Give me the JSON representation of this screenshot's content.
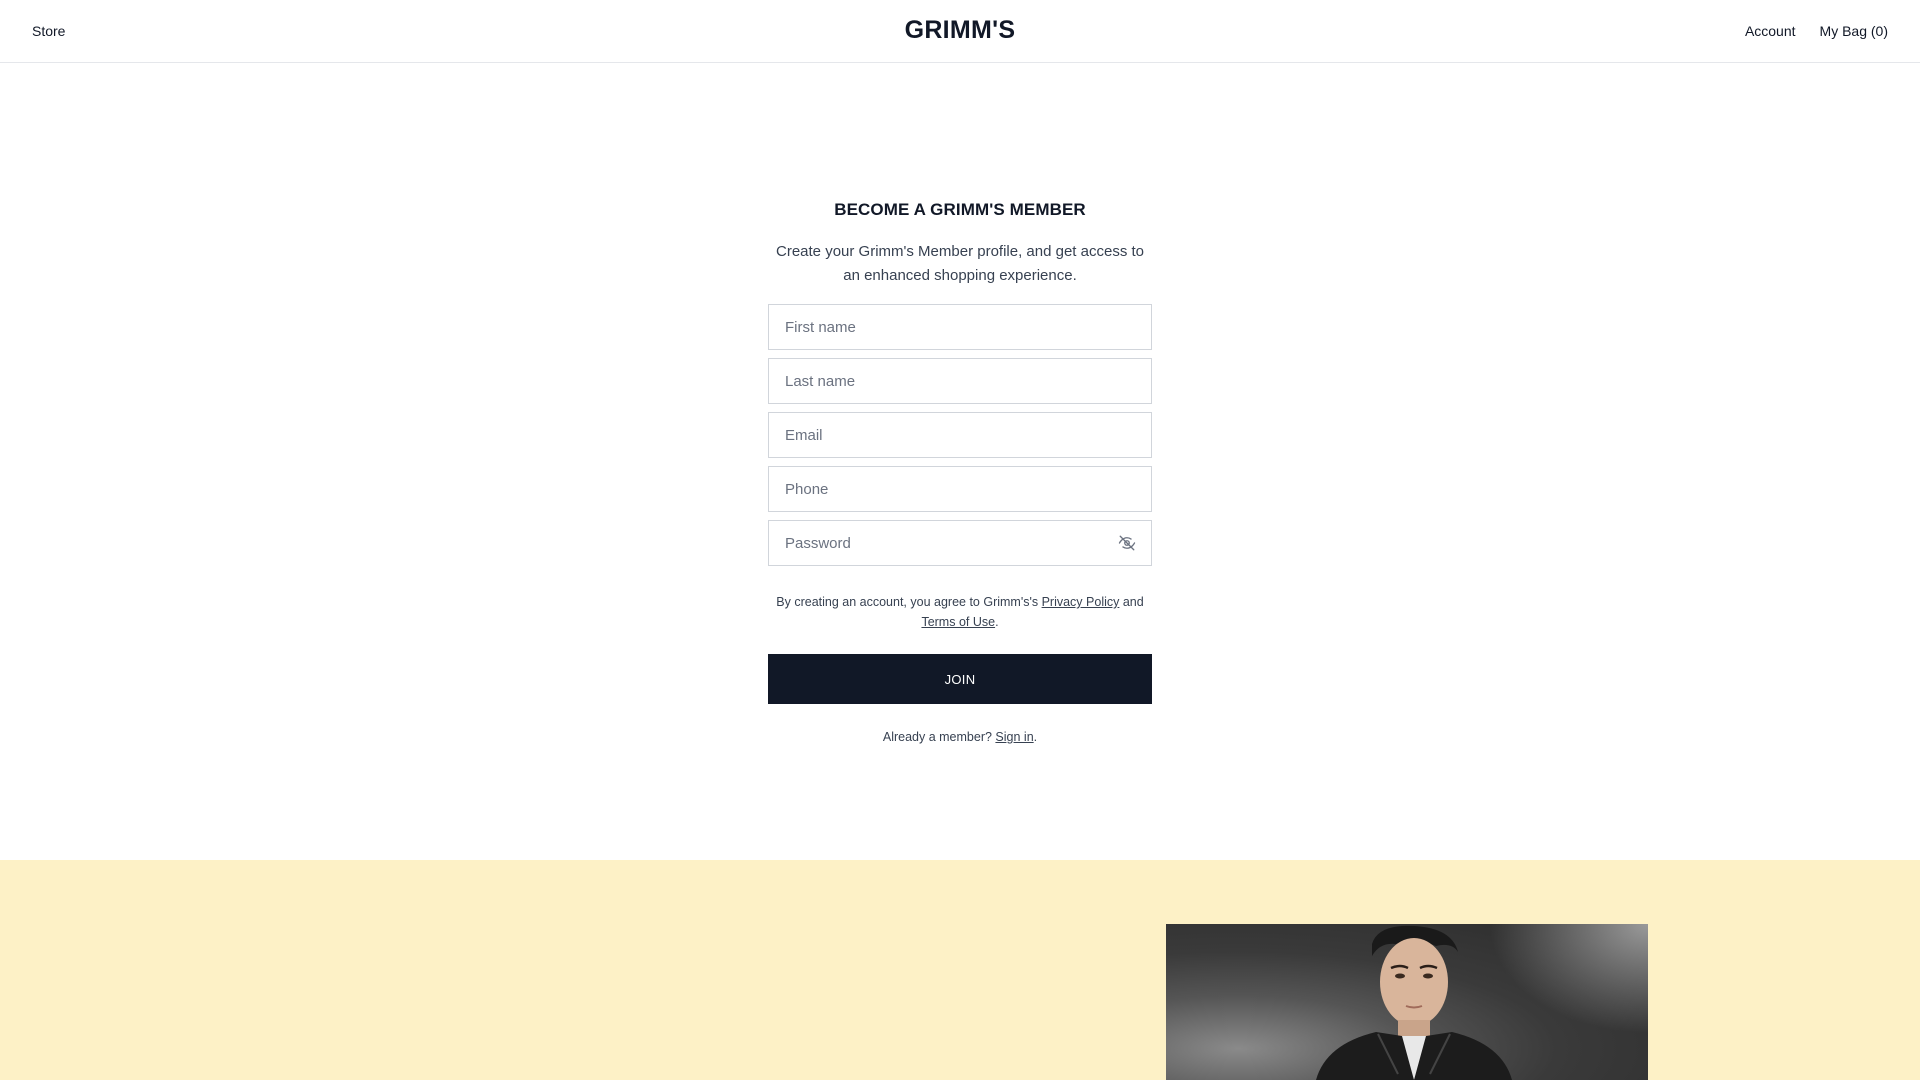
{
  "header": {
    "store_label": "Store",
    "brand": "GRIMM'S",
    "account_label": "Account",
    "bag_label": "My Bag (0)"
  },
  "signup": {
    "title": "BECOME A GRIMM'S MEMBER",
    "subtitle": "Create your Grimm's Member profile, and get access to an enhanced shopping experience.",
    "fields": {
      "first_name": {
        "placeholder": "First name",
        "value": ""
      },
      "last_name": {
        "placeholder": "Last name",
        "value": ""
      },
      "email": {
        "placeholder": "Email",
        "value": ""
      },
      "phone": {
        "placeholder": "Phone",
        "value": ""
      },
      "password": {
        "placeholder": "Password",
        "value": "",
        "toggle_icon": "eye-off-icon"
      }
    },
    "legal": {
      "prefix": "By creating an account, you agree to Grimm's's ",
      "privacy_link": "Privacy Policy",
      "middle": " and ",
      "terms_link": "Terms of Use",
      "suffix": "."
    },
    "join_label": "JOIN",
    "signin": {
      "prefix": "Already a member? ",
      "link": "Sign in",
      "suffix": "."
    }
  },
  "promo": {
    "background_color": "#fdf1c6"
  },
  "colors": {
    "primary_button": "#111827",
    "text": "#111827",
    "muted_text": "#374151"
  }
}
